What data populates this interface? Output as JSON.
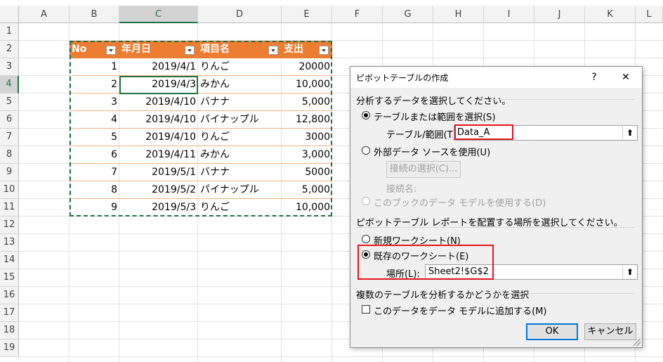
{
  "sheet": {
    "columns": [
      "A",
      "B",
      "C",
      "D",
      "E",
      "F",
      "G",
      "H",
      "I",
      "J",
      "K",
      "L"
    ],
    "rows": [
      "1",
      "2",
      "3",
      "4",
      "5",
      "6",
      "7",
      "8",
      "9",
      "10",
      "11",
      "12",
      "13",
      "14",
      "15",
      "16",
      "17",
      "18",
      "19"
    ],
    "table": {
      "headers": [
        "No",
        "年月日",
        "項目名",
        "支出"
      ],
      "rows": [
        [
          "1",
          "2019/4/1",
          "りんご",
          "20000"
        ],
        [
          "2",
          "2019/4/3",
          "みかん",
          "10,000"
        ],
        [
          "3",
          "2019/4/10",
          "バナナ",
          "5,000"
        ],
        [
          "4",
          "2019/4/10",
          "パイナップル",
          "12,800"
        ],
        [
          "5",
          "2019/4/10",
          "りんご",
          "3000"
        ],
        [
          "6",
          "2019/4/11",
          "みかん",
          "3,000"
        ],
        [
          "7",
          "2019/5/1",
          "バナナ",
          "5000"
        ],
        [
          "8",
          "2019/5/2",
          "パイナップル",
          "5,000"
        ],
        [
          "9",
          "2019/5/3",
          "りんご",
          "10,000"
        ]
      ]
    },
    "colors": {
      "header_bg": "#ed7d31",
      "selection": "#217346"
    }
  },
  "dialog": {
    "title": "ピボットテーブルの作成",
    "help": "?",
    "close": "✕",
    "section1": "分析するデータを選択してください。",
    "opt_table": "テーブルまたは範囲を選択(S)",
    "range_label": "テーブル/範囲(T):",
    "range_value": "Data_A",
    "opt_external": "外部データ ソースを使用(U)",
    "choose_conn": "接続の選択(C)...",
    "conn_name": "接続名:",
    "opt_model": "このブックのデータ モデルを使用する(D)",
    "section2": "ピボットテーブル レポートを配置する場所を選択してください。",
    "opt_new": "新規ワークシート(N)",
    "opt_existing": "既存のワークシート(E)",
    "loc_label": "場所(L):",
    "loc_value": "Sheet2!$G$2",
    "section3": "複数のテーブルを分析するかどうかを選択",
    "add_model": "このデータをデータ モデルに追加する(M)",
    "ok": "OK",
    "cancel": "キャンセル",
    "collapse_icon": "⬆"
  }
}
